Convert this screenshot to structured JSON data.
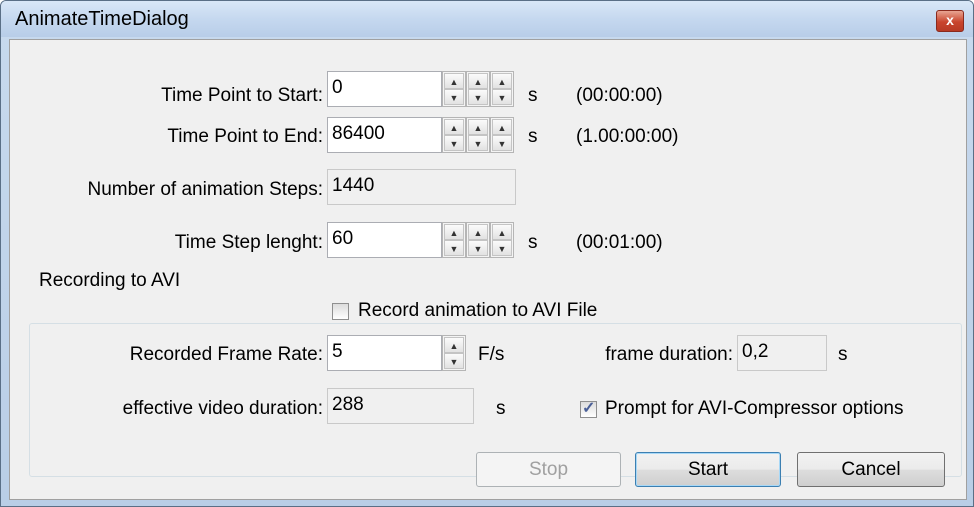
{
  "window": {
    "title": "AnimateTimeDialog",
    "close_glyph": "x"
  },
  "time_start": {
    "label": "Time Point to Start:",
    "value": "0",
    "unit": "s",
    "formatted": "(00:00:00)"
  },
  "time_end": {
    "label": "Time Point to End:",
    "value": "86400",
    "unit": "s",
    "formatted": "(1.00:00:00)"
  },
  "steps": {
    "label": "Number of animation Steps:",
    "value": "1440"
  },
  "step_length": {
    "label": "Time Step lenght:",
    "value": "60",
    "unit": "s",
    "formatted": "(00:01:00)"
  },
  "recording": {
    "group_title": "Recording to AVI",
    "record_checkbox": {
      "label": "Record animation to AVI File",
      "checked": false
    },
    "frame_rate": {
      "label": "Recorded Frame Rate:",
      "value": "5",
      "unit": "F/s"
    },
    "frame_duration": {
      "label": "frame duration:",
      "value": "0,2",
      "unit": "s"
    },
    "video_duration": {
      "label": "effective video duration:",
      "value": "288",
      "unit": "s"
    },
    "prompt_checkbox": {
      "label": "Prompt for AVI-Compressor options",
      "checked": true
    }
  },
  "buttons": {
    "stop": "Stop",
    "start": "Start",
    "cancel": "Cancel"
  }
}
